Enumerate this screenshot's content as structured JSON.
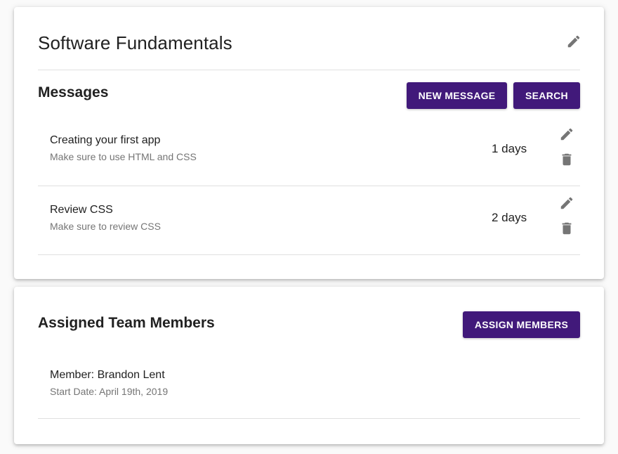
{
  "course": {
    "title": "Software Fundamentals",
    "edit_icon": "pencil-icon"
  },
  "messages": {
    "heading": "Messages",
    "new_message_label": "NEW MESSAGE",
    "search_label": "SEARCH",
    "items": [
      {
        "title": "Creating your first app",
        "subtitle": "Make sure to use HTML and CSS",
        "age": "1 days",
        "edit_icon": "pencil-icon",
        "delete_icon": "trash-icon"
      },
      {
        "title": "Review CSS",
        "subtitle": "Make sure to review CSS",
        "age": "2 days",
        "edit_icon": "pencil-icon",
        "delete_icon": "trash-icon"
      }
    ]
  },
  "team": {
    "heading": "Assigned Team Members",
    "assign_label": "ASSIGN MEMBERS",
    "members": [
      {
        "name": "Member: Brandon Lent",
        "start_date": "Start Date: April 19th, 2019"
      }
    ]
  },
  "theme": {
    "accent": "#41197a",
    "icon_color": "#757575",
    "divider": "#e0e0e0"
  }
}
